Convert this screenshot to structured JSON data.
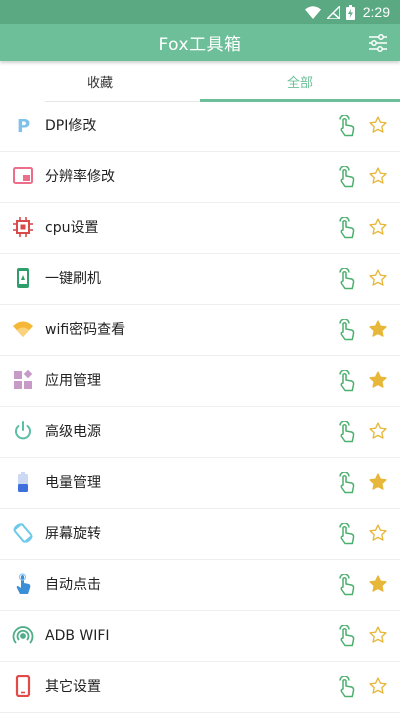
{
  "status_bar": {
    "time": "2:29"
  },
  "app_bar": {
    "title": "Fox工具箱",
    "filter_icon": "sliders-icon"
  },
  "tabs": [
    {
      "label": "收藏",
      "active": false
    },
    {
      "label": "全部",
      "active": true
    }
  ],
  "colors": {
    "accent": "#6cbf98",
    "status_bar": "#5aa983",
    "star_filled": "#e7b739",
    "touch_icon": "#4caf6e"
  },
  "items": [
    {
      "label": "DPI修改",
      "icon": "letter-p-icon",
      "starred": false
    },
    {
      "label": "分辨率修改",
      "icon": "window-icon",
      "starred": false
    },
    {
      "label": "cpu设置",
      "icon": "chip-icon",
      "starred": false
    },
    {
      "label": "一键刷机",
      "icon": "phone-android-icon",
      "starred": false
    },
    {
      "label": "wifi密码查看",
      "icon": "wifi-icon",
      "starred": true
    },
    {
      "label": "应用管理",
      "icon": "apps-grid-icon",
      "starred": true
    },
    {
      "label": "高级电源",
      "icon": "power-icon",
      "starred": false
    },
    {
      "label": "电量管理",
      "icon": "battery-icon",
      "starred": true
    },
    {
      "label": "屏幕旋转",
      "icon": "screen-rotate-icon",
      "starred": false
    },
    {
      "label": "自动点击",
      "icon": "tap-hand-icon",
      "starred": true
    },
    {
      "label": "ADB WIFI",
      "icon": "adb-wifi-icon",
      "starred": false
    },
    {
      "label": "其它设置",
      "icon": "phone-outline-icon",
      "starred": false
    }
  ]
}
